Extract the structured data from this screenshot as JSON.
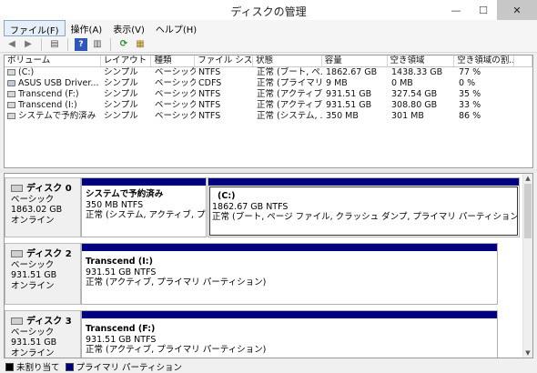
{
  "window": {
    "title": "ディスクの管理",
    "minimize": "—",
    "maximize": "☐",
    "close": "✕"
  },
  "menu": [
    "ファイル(F)",
    "操作(A)",
    "表示(V)",
    "ヘルプ(H)"
  ],
  "toolbar": {
    "back": "◀",
    "forward": "▶",
    "list": "▤",
    "help": "?",
    "panel": "▥",
    "refresh": "⟳",
    "props": "▦"
  },
  "volume_table": {
    "columns": [
      "ボリューム",
      "レイアウト",
      "種類",
      "ファイル シス...",
      "状態",
      "容量",
      "空き領域",
      "空き領域の割...",
      ""
    ],
    "rows": [
      {
        "icon": "drive-icon",
        "cells": [
          "(C:)",
          "シンプル",
          "ベーシック",
          "NTFS",
          "正常 (ブート, ペ...",
          "1862.67 GB",
          "1438.33 GB",
          "77 %"
        ]
      },
      {
        "icon": "cd-icon",
        "cells": [
          "ASUS USB Driver...",
          "シンプル",
          "ベーシック",
          "CDFS",
          "正常 (プライマリ ...",
          "9 MB",
          "0 MB",
          "0 %"
        ]
      },
      {
        "icon": "drive-icon",
        "cells": [
          "Transcend (F:)",
          "シンプル",
          "ベーシック",
          "NTFS",
          "正常 (アクティブ,...",
          "931.51 GB",
          "327.54 GB",
          "35 %"
        ]
      },
      {
        "icon": "drive-icon",
        "cells": [
          "Transcend (I:)",
          "シンプル",
          "ベーシック",
          "NTFS",
          "正常 (アクティブ,...",
          "931.51 GB",
          "308.80 GB",
          "33 %"
        ]
      },
      {
        "icon": "drive-icon",
        "cells": [
          "システムで予約済み",
          "シンプル",
          "ベーシック",
          "NTFS",
          "正常 (システム, ...",
          "350 MB",
          "301 MB",
          "86 %"
        ]
      }
    ]
  },
  "disks": [
    {
      "name": "ディスク 0",
      "type": "ベーシック",
      "size": "1863.02 GB",
      "status": "オンライン",
      "partitions": [
        {
          "name": "システムで予約済み",
          "size": "350 MB NTFS",
          "status": "正常 (システム, アクティブ, プライマリ"
        },
        {
          "name": "(C:)",
          "size": "1862.67 GB NTFS",
          "status": "正常 (ブート, ページ ファイル, クラッシュ ダンプ, プライマリ パーティション)"
        }
      ]
    },
    {
      "name": "ディスク 2",
      "type": "ベーシック",
      "size": "931.51 GB",
      "status": "オンライン",
      "partitions": [
        {
          "name": "Transcend (I:)",
          "size": "931.51 GB NTFS",
          "status": "正常 (アクティブ, プライマリ パーティション)"
        }
      ]
    },
    {
      "name": "ディスク 3",
      "type": "ベーシック",
      "size": "931.51 GB",
      "status": "オンライン",
      "partitions": [
        {
          "name": "Transcend (F:)",
          "size": "931.51 GB NTFS",
          "status": "正常 (アクティブ, プライマリ パーティション)"
        }
      ]
    }
  ],
  "legend": [
    {
      "label": "未割り当て",
      "color": "#000000"
    },
    {
      "label": "プライマリ パーティション",
      "color": "#00007e"
    }
  ]
}
